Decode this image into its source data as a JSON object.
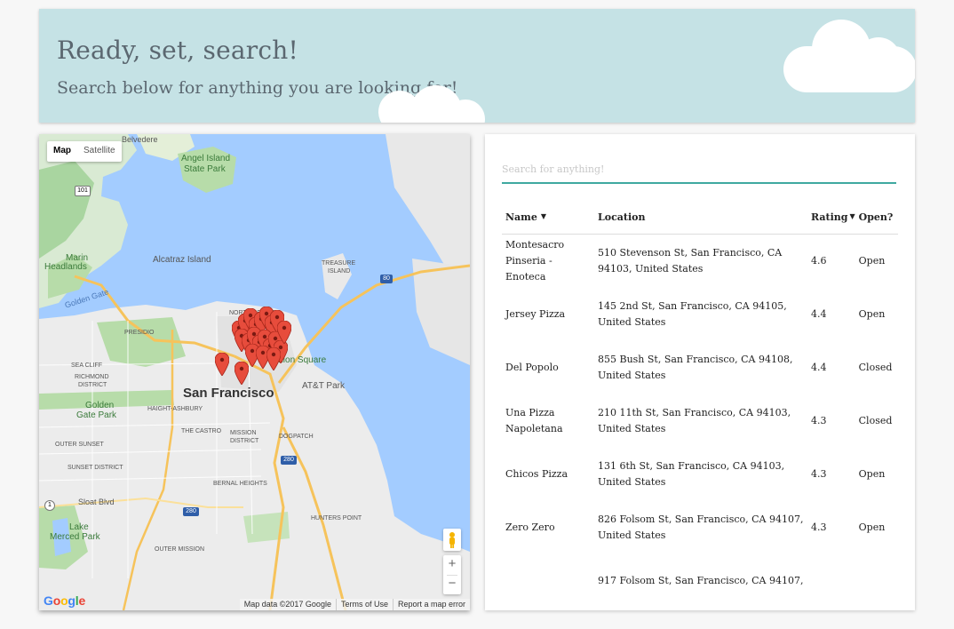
{
  "header": {
    "title": "Ready, set, search!",
    "subtitle": "Search below for anything you are looking for!"
  },
  "map": {
    "type_map": "Map",
    "type_satellite": "Satellite",
    "zoom_in": "+",
    "zoom_out": "−",
    "logo": "Google",
    "attribution": {
      "data": "Map data ©2017 Google",
      "terms": "Terms of Use",
      "report": "Report a map error"
    },
    "labels": {
      "belvedere": "Belvedere",
      "angel_island": "Angel Island",
      "angel_island_park": "State Park",
      "marin_headlands": "Marin",
      "marin_headlands2": "Headlands",
      "alcatraz": "Alcatraz Island",
      "treasure_island": "TREASURE",
      "treasure_island2": "ISLAND",
      "golden_gate": "Golden Gate",
      "north_beach": "NORTH BEACH",
      "presidio": "PRESIDIO",
      "sea_cliff": "SEA CLIFF",
      "richmond": "RICHMOND",
      "richmond2": "DISTRICT",
      "gg_park": "Golden",
      "gg_park2": "Gate Park",
      "haight": "HAIGHT-ASHBURY",
      "san_francisco": "San Francisco",
      "att_park": "AT&T Park",
      "union_square": "Union Square",
      "the_castro": "THE CASTRO",
      "mission": "MISSION",
      "mission2": "DISTRICT",
      "dogpatch": "DOGPATCH",
      "outer_sunset": "OUTER SUNSET",
      "sunset": "SUNSET DISTRICT",
      "bernal": "BERNAL HEIGHTS",
      "sloat": "Sloat Blvd",
      "lake_merced": "Lake",
      "lake_merced2": "Merced Park",
      "hunters_point": "HUNTERS POINT",
      "outer_mission": "OUTER MISSION",
      "hwy101": "101",
      "hwy80": "80",
      "hwy280": "280",
      "hwy1": "1"
    }
  },
  "search": {
    "placeholder": "Search for anything!",
    "value": ""
  },
  "table": {
    "headers": {
      "name": "Name",
      "location": "Location",
      "rating": "Rating",
      "open": "Open?"
    },
    "rows": [
      {
        "name": "Montesacro Pinseria - Enoteca",
        "location": "510 Stevenson St, San Francisco, CA 94103, United States",
        "rating": "4.6",
        "open": "Open"
      },
      {
        "name": "Jersey Pizza",
        "location": "145 2nd St, San Francisco, CA 94105, United States",
        "rating": "4.4",
        "open": "Open"
      },
      {
        "name": "Del Popolo",
        "location": "855 Bush St, San Francisco, CA 94108, United States",
        "rating": "4.4",
        "open": "Closed"
      },
      {
        "name": "Una Pizza Napoletana",
        "location": "210 11th St, San Francisco, CA 94103, United States",
        "rating": "4.3",
        "open": "Closed"
      },
      {
        "name": "Chicos Pizza",
        "location": "131 6th St, San Francisco, CA 94103, United States",
        "rating": "4.3",
        "open": "Open"
      },
      {
        "name": "Zero Zero",
        "location": "826 Folsom St, San Francisco, CA 94107, United States",
        "rating": "4.3",
        "open": "Open"
      },
      {
        "name": "",
        "location": "917 Folsom St, San Francisco, CA 94107,",
        "rating": "",
        "open": ""
      }
    ]
  },
  "colors": {
    "header_bg": "#c5e2e5",
    "accent": "#3fa9a0",
    "marker": "#e74c3c",
    "water": "#a3ccff"
  }
}
